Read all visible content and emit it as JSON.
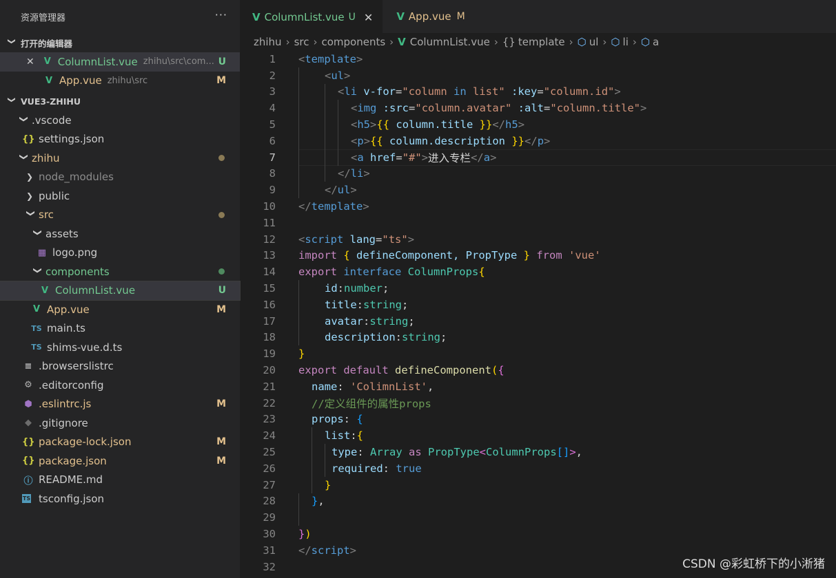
{
  "sidebar": {
    "title": "资源管理器",
    "more": "···",
    "open_editors": {
      "header": "打开的编辑器",
      "items": [
        {
          "close": "✕",
          "name": "ColumnList.vue",
          "desc": "zhihu\\src\\com...",
          "status": "U"
        },
        {
          "name": "App.vue",
          "desc": "zhihu\\src",
          "status": "M"
        }
      ]
    },
    "project": {
      "header": "VUE3-ZHIHU",
      "vscode": ".vscode",
      "settings": "settings.json",
      "zhihu": "zhihu",
      "node_modules": "node_modules",
      "public": "public",
      "src": "src",
      "assets": "assets",
      "logo": "logo.png",
      "components": "components",
      "columnlist": "ColumnList.vue",
      "columnlist_status": "U",
      "appvue": "App.vue",
      "appvue_status": "M",
      "main": "main.ts",
      "shims": "shims-vue.d.ts",
      "browserslist": ".browserslistrc",
      "editorconfig": ".editorconfig",
      "eslintrc": ".eslintrc.js",
      "eslintrc_status": "M",
      "gitignore": ".gitignore",
      "pkglock": "package-lock.json",
      "pkglock_status": "M",
      "pkg": "package.json",
      "pkg_status": "M",
      "readme": "README.md",
      "tsconfig": "tsconfig.json"
    }
  },
  "tabs": [
    {
      "label": "ColumnList.vue",
      "status": "U",
      "close": "✕"
    },
    {
      "label": "App.vue",
      "status": "M"
    }
  ],
  "breadcrumb": {
    "items": [
      "zhihu",
      "src",
      "components",
      "ColumnList.vue",
      "template",
      "ul",
      "li",
      "a"
    ],
    "braces": "{}"
  },
  "line_numbers": [
    "1",
    "2",
    "3",
    "4",
    "5",
    "6",
    "7",
    "8",
    "9",
    "10",
    "11",
    "12",
    "13",
    "14",
    "15",
    "16",
    "17",
    "18",
    "19",
    "20",
    "21",
    "22",
    "23",
    "24",
    "25",
    "26",
    "27",
    "28",
    "29",
    "30",
    "31",
    "32"
  ],
  "code": {
    "l1": [
      "<",
      "template",
      ">"
    ],
    "l2": [
      "<",
      "ul",
      ">"
    ],
    "l3": [
      "<",
      "li",
      " v-for",
      "=",
      "\"column",
      " in",
      " list\"",
      " :key",
      "=",
      "\"column.id\"",
      ">"
    ],
    "l4": [
      "<",
      "img",
      " :src",
      "=",
      "\"column.avatar\"",
      " :alt",
      "=",
      "\"column.title\"",
      ">"
    ],
    "l5": [
      "<",
      "h5",
      ">",
      "{{ ",
      "column.title",
      " }}",
      "</",
      "h5",
      ">"
    ],
    "l6": [
      "<",
      "p",
      ">",
      "{{ ",
      "column.description",
      " }}",
      "</",
      "p",
      ">"
    ],
    "l7": [
      "<",
      "a",
      " href",
      "=",
      "\"#\"",
      ">",
      "进入专栏",
      "</",
      "a",
      ">"
    ],
    "l8": [
      "</",
      "li",
      ">"
    ],
    "l9": [
      "</",
      "ul",
      ">"
    ],
    "l10": [
      "</",
      "template",
      ">"
    ],
    "l12": [
      "<",
      "script",
      " lang",
      "=",
      "\"ts\"",
      ">"
    ],
    "l13": [
      "import",
      " ",
      "{",
      " defineComponent, PropType ",
      "}",
      " from ",
      "'vue'"
    ],
    "l14": [
      "export",
      " interface ",
      "ColumnProps",
      "{"
    ],
    "l15": [
      "id",
      ":",
      "number",
      ";"
    ],
    "l16": [
      "title",
      ":",
      "string",
      ";"
    ],
    "l17": [
      "avatar",
      ":",
      "string",
      ";"
    ],
    "l18": [
      "description",
      ":",
      "string",
      ";"
    ],
    "l19": [
      "}"
    ],
    "l20": [
      "export",
      " default ",
      "defineComponent",
      "(",
      "{"
    ],
    "l21": [
      "name",
      ": ",
      "'ColimnList'",
      ","
    ],
    "l22": [
      "//定义组件的属性props"
    ],
    "l23": [
      "props",
      ": ",
      "{"
    ],
    "l24": [
      "list",
      ":",
      "{"
    ],
    "l25": [
      "type",
      ": ",
      "Array",
      " as ",
      "PropType",
      "<",
      "ColumnProps",
      "[]",
      ">",
      ","
    ],
    "l26": [
      "required",
      ": ",
      "true"
    ],
    "l27": [
      "}"
    ],
    "l28": [
      "}",
      ","
    ],
    "l30": [
      "}",
      ")"
    ],
    "l31": [
      "</",
      "script",
      ">"
    ]
  },
  "watermark": "CSDN @彩虹桥下的小淅猪",
  "colors": {
    "vue": "#41b883",
    "modified": "#e2c08d",
    "untracked": "#73c991",
    "ts": "#519aba",
    "json": "#cbcb41"
  }
}
